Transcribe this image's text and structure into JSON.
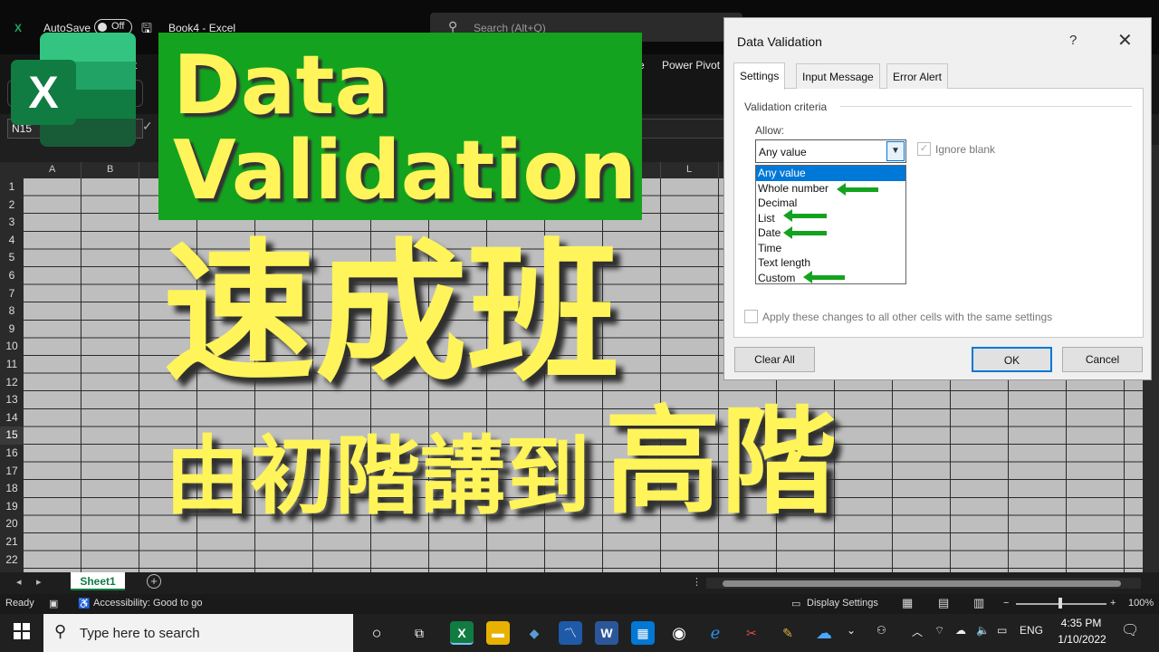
{
  "titlebar": {
    "autosave_label": "AutoSave",
    "autosave_state": "Off",
    "document_title": "Book4 - Excel",
    "search_placeholder": "Search (Alt+Q)"
  },
  "ribbon": {
    "tabs": [
      "t",
      "e",
      "Power Pivot"
    ]
  },
  "formula_bar": {
    "name_box": "N15"
  },
  "grid": {
    "columns": [
      "A",
      "B",
      "L"
    ],
    "rows": [
      "1",
      "2",
      "3",
      "4",
      "5",
      "6",
      "7",
      "8",
      "9",
      "10",
      "11",
      "12",
      "13",
      "14",
      "15",
      "16",
      "17",
      "18",
      "19",
      "20",
      "21",
      "22"
    ],
    "active_row": "15"
  },
  "sheets": {
    "tabs": [
      "Sheet1"
    ],
    "add_label": "+"
  },
  "statusbar": {
    "ready": "Ready",
    "accessibility": "Accessibility: Good to go",
    "display_settings": "Display Settings",
    "zoom_minus": "−",
    "zoom_plus": "+",
    "zoom": "100%"
  },
  "overlay": {
    "title_line1": "Data",
    "title_line2": "Validation",
    "headline": "速成班",
    "subline_small": "由初階講到",
    "subline_large": "高階",
    "accent_color": "#fff45a",
    "banner_color": "#14a31f"
  },
  "dialog": {
    "title": "Data Validation",
    "help": "?",
    "close": "✕",
    "tabs": [
      "Settings",
      "Input Message",
      "Error Alert"
    ],
    "active_tab": "Settings",
    "criteria_label": "Validation criteria",
    "allow_label": "Allow:",
    "allow_value": "Any value",
    "ignore_blank": "Ignore blank",
    "options": [
      "Any value",
      "Whole number",
      "Decimal",
      "List",
      "Date",
      "Time",
      "Text length",
      "Custom"
    ],
    "highlighted_options": [
      "Whole number",
      "List",
      "Date",
      "Custom"
    ],
    "apply_all": "Apply these changes to all other cells with the same settings",
    "buttons": {
      "clear_all": "Clear All",
      "ok": "OK",
      "cancel": "Cancel"
    }
  },
  "taskbar": {
    "search_placeholder": "Type here to search",
    "language": "ENG",
    "time": "4:35 PM",
    "date": "1/10/2022"
  }
}
